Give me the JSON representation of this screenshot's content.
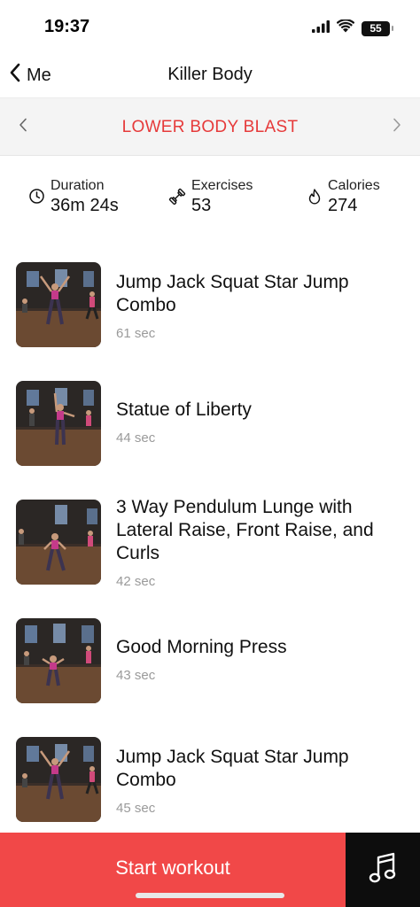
{
  "status_bar": {
    "time": "19:37",
    "battery": "55"
  },
  "nav": {
    "back_label": "Me",
    "title": "Killer Body"
  },
  "program": {
    "name": "LOWER BODY BLAST"
  },
  "stats": {
    "duration": {
      "label": "Duration",
      "value": "36m 24s",
      "icon": "clock-icon"
    },
    "exercises": {
      "label": "Exercises",
      "value": "53",
      "icon": "dumbbell-icon"
    },
    "calories": {
      "label": "Calories",
      "value": "274",
      "icon": "flame-icon"
    }
  },
  "exercises": [
    {
      "name": "Jump Jack Squat Star Jump Combo",
      "duration": "61 sec"
    },
    {
      "name": "Statue of Liberty",
      "duration": "44 sec"
    },
    {
      "name": "3 Way Pendulum Lunge with Lateral Raise, Front Raise, and Curls",
      "duration": "42 sec"
    },
    {
      "name": "Good Morning Press",
      "duration": "43 sec"
    },
    {
      "name": "Jump Jack Squat Star Jump Combo",
      "duration": "45 sec"
    }
  ],
  "actions": {
    "start_label": "Start workout",
    "music_icon": "music-note-icon"
  },
  "colors": {
    "accent": "#f14848",
    "program_title": "#e63a3a",
    "music_bg": "#0d0d0d"
  }
}
